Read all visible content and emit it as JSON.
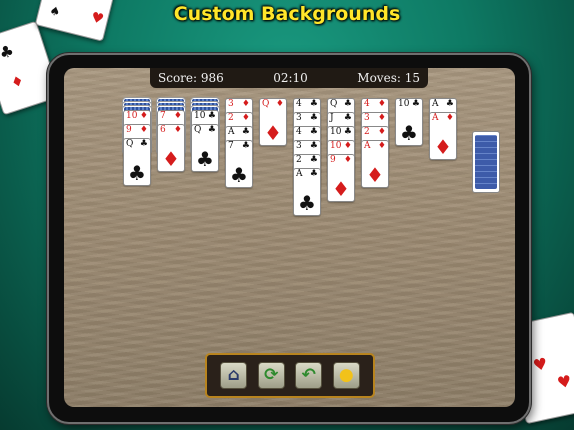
{
  "banner": {
    "title": "Custom Backgrounds"
  },
  "status": {
    "score": "Score: 986",
    "time": "02:10",
    "moves": "Moves: 15"
  },
  "tableau": [
    {
      "face_down": 3,
      "face_up": [
        {
          "rank": "10",
          "suit": "♦",
          "color": "red"
        },
        {
          "rank": "9",
          "suit": "♦",
          "color": "red"
        },
        {
          "rank": "Q",
          "suit": "♣",
          "color": "black"
        }
      ]
    },
    {
      "face_down": 3,
      "face_up": [
        {
          "rank": "7",
          "suit": "♦",
          "color": "red"
        },
        {
          "rank": "6",
          "suit": "♦",
          "color": "red"
        }
      ]
    },
    {
      "face_down": 3,
      "face_up": [
        {
          "rank": "10",
          "suit": "♣",
          "color": "black"
        },
        {
          "rank": "Q",
          "suit": "♣",
          "color": "black"
        }
      ]
    },
    {
      "face_down": 0,
      "face_up": [
        {
          "rank": "3",
          "suit": "♦",
          "color": "red"
        },
        {
          "rank": "2",
          "suit": "♦",
          "color": "red"
        },
        {
          "rank": "A",
          "suit": "♣",
          "color": "black"
        },
        {
          "rank": "7",
          "suit": "♣",
          "color": "black"
        }
      ]
    },
    {
      "face_down": 0,
      "face_up": [
        {
          "rank": "Q",
          "suit": "♦",
          "color": "red"
        }
      ]
    },
    {
      "face_down": 0,
      "face_up": [
        {
          "rank": "4",
          "suit": "♣",
          "color": "black"
        },
        {
          "rank": "3",
          "suit": "♣",
          "color": "black"
        },
        {
          "rank": "4",
          "suit": "♣",
          "color": "black"
        },
        {
          "rank": "3",
          "suit": "♣",
          "color": "black"
        },
        {
          "rank": "2",
          "suit": "♣",
          "color": "black"
        },
        {
          "rank": "A",
          "suit": "♣",
          "color": "black"
        }
      ]
    },
    {
      "face_down": 0,
      "face_up": [
        {
          "rank": "Q",
          "suit": "♣",
          "color": "black"
        },
        {
          "rank": "J",
          "suit": "♣",
          "color": "black"
        },
        {
          "rank": "10",
          "suit": "♣",
          "color": "black"
        },
        {
          "rank": "10",
          "suit": "♦",
          "color": "red"
        },
        {
          "rank": "9",
          "suit": "♦",
          "color": "red"
        }
      ]
    },
    {
      "face_down": 0,
      "face_up": [
        {
          "rank": "4",
          "suit": "♦",
          "color": "red"
        },
        {
          "rank": "3",
          "suit": "♦",
          "color": "red"
        },
        {
          "rank": "2",
          "suit": "♦",
          "color": "red"
        },
        {
          "rank": "A",
          "suit": "♦",
          "color": "red"
        }
      ]
    },
    {
      "face_down": 0,
      "face_up": [
        {
          "rank": "10",
          "suit": "♣",
          "color": "black"
        }
      ]
    },
    {
      "face_down": 0,
      "face_up": [
        {
          "rank": "A",
          "suit": "♣",
          "color": "black"
        },
        {
          "rank": "A",
          "suit": "♦",
          "color": "red"
        }
      ]
    }
  ],
  "toolbar": {
    "buttons": [
      {
        "name": "home-button",
        "icon": "home-icon",
        "glyph": "⌂",
        "color": "#2b3a6a"
      },
      {
        "name": "new-game-button",
        "icon": "refresh-icon",
        "glyph": "⟳",
        "color": "#2e8a2e"
      },
      {
        "name": "undo-button",
        "icon": "undo-arrow-icon",
        "glyph": "↶",
        "color": "#2e8a2e"
      },
      {
        "name": "hint-button",
        "icon": "lightbulb-icon",
        "glyph": "●",
        "color": "#f2c21a"
      }
    ]
  },
  "colors": {
    "accent": "#ffe62a",
    "felt": "#0e7a64",
    "frame": "#b8841f"
  }
}
